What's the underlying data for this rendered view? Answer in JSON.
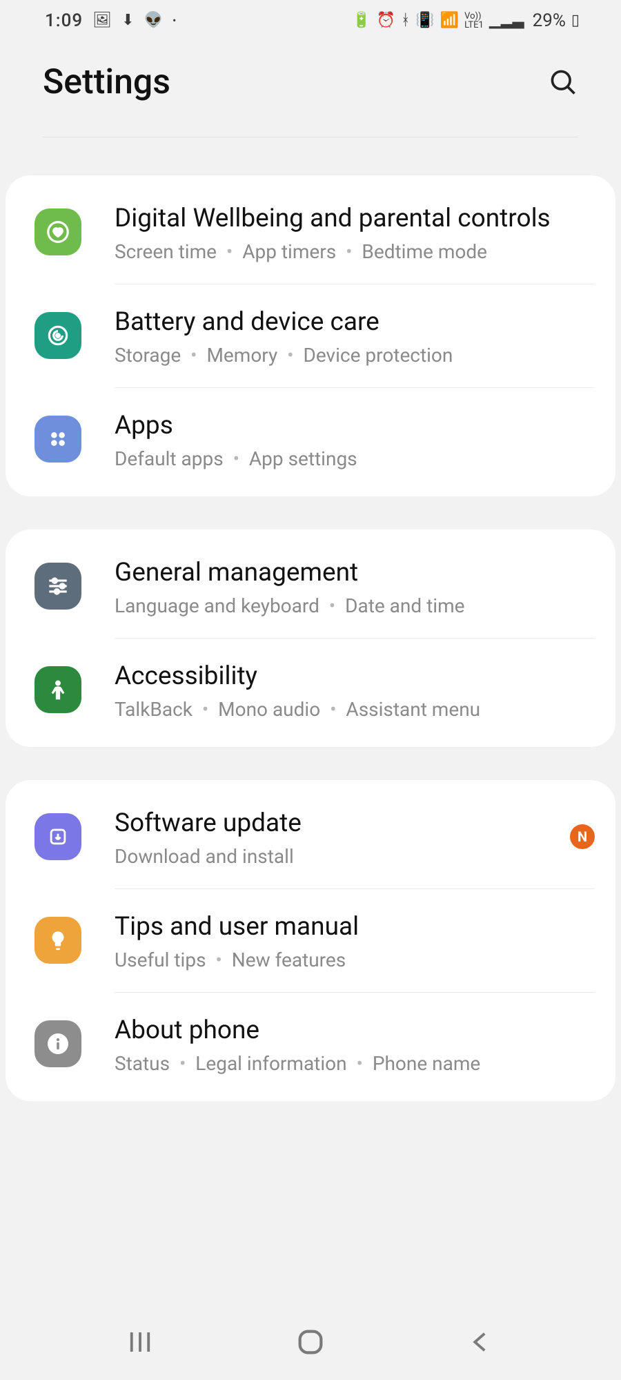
{
  "status": {
    "time": "1:09",
    "battery": "29%"
  },
  "header": {
    "title": "Settings"
  },
  "groups": [
    {
      "items": [
        {
          "id": "digital-wellbeing",
          "title": "Digital Wellbeing and parental controls",
          "subs": [
            "Screen time",
            "App timers",
            "Bedtime mode"
          ],
          "color": "#6fbb4b",
          "badge": null,
          "iconSvg": "heart"
        },
        {
          "id": "battery-device-care",
          "title": "Battery and device care",
          "subs": [
            "Storage",
            "Memory",
            "Device protection"
          ],
          "color": "#1f9e84",
          "badge": null,
          "iconSvg": "care"
        },
        {
          "id": "apps",
          "title": "Apps",
          "subs": [
            "Default apps",
            "App settings"
          ],
          "color": "#6d8fdc",
          "badge": null,
          "iconSvg": "dots"
        }
      ]
    },
    {
      "items": [
        {
          "id": "general-management",
          "title": "General management",
          "subs": [
            "Language and keyboard",
            "Date and time"
          ],
          "color": "#5e6d7c",
          "badge": null,
          "iconSvg": "sliders"
        },
        {
          "id": "accessibility",
          "title": "Accessibility",
          "subs": [
            "TalkBack",
            "Mono audio",
            "Assistant menu"
          ],
          "color": "#2b8a3e",
          "badge": null,
          "iconSvg": "person"
        }
      ]
    },
    {
      "items": [
        {
          "id": "software-update",
          "title": "Software update",
          "subs": [
            "Download and install"
          ],
          "color": "#7b77e6",
          "badge": "N",
          "iconSvg": "update"
        },
        {
          "id": "tips",
          "title": "Tips and user manual",
          "subs": [
            "Useful tips",
            "New features"
          ],
          "color": "#eea43a",
          "badge": null,
          "iconSvg": "bulb"
        },
        {
          "id": "about-phone",
          "title": "About phone",
          "subs": [
            "Status",
            "Legal information",
            "Phone name"
          ],
          "color": "#8d8d8d",
          "badge": null,
          "iconSvg": "info"
        }
      ]
    }
  ]
}
